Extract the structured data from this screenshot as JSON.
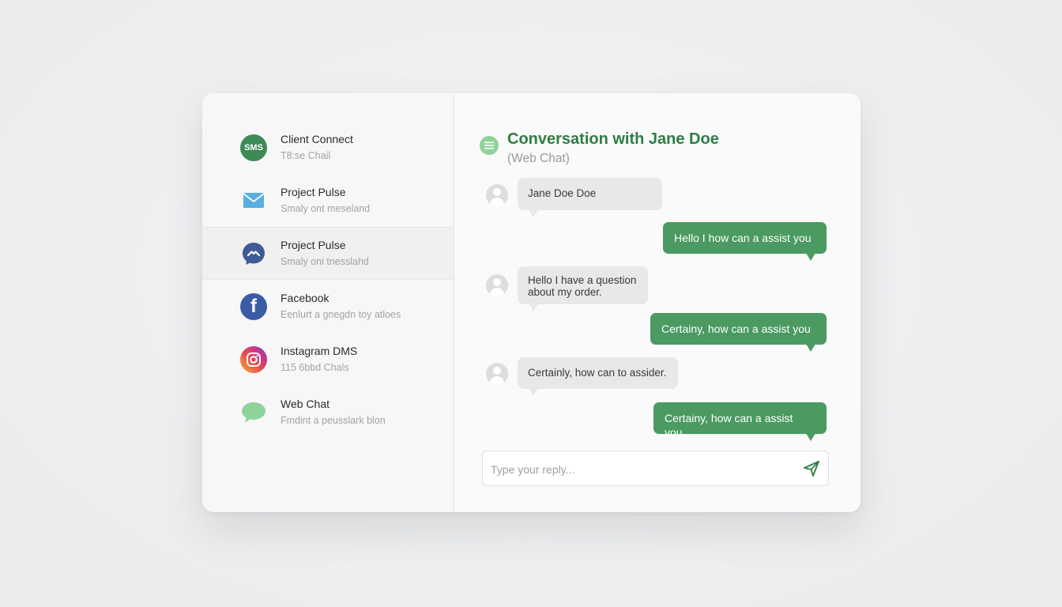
{
  "sidebar": {
    "channels": [
      {
        "name": "Client Connect",
        "subtitle": "T8:se Chail",
        "icon": "sms-badge-icon",
        "badge": "SMS"
      },
      {
        "name": "Project Pulse",
        "subtitle": "Smaly ont meseland",
        "icon": "envelope-icon"
      },
      {
        "name": "Project Pulse",
        "subtitle": "Smaly oni tnesslahd",
        "icon": "messenger-icon",
        "active": true
      },
      {
        "name": "Facebook",
        "subtitle": "Eenlurt a gnegdn toy atloes",
        "icon": "facebook-icon",
        "glyph": "f"
      },
      {
        "name": "Instagram DMS",
        "subtitle": "115 6bbd Chals",
        "icon": "instagram-icon"
      },
      {
        "name": "Web Chat",
        "subtitle": "Fmdint a peusslark blon",
        "icon": "chat-bubble-icon"
      }
    ]
  },
  "conversation": {
    "title": "Conversation with Jane Doe",
    "subtitle": "(Web Chat)",
    "header_icon": "menu-lines-icon",
    "messages": [
      {
        "direction": "in",
        "text": "Jane Doe Doe"
      },
      {
        "direction": "out",
        "text": "Hello  I how can a assist you"
      },
      {
        "direction": "in",
        "text": "Hello I have a question about my order."
      },
      {
        "direction": "out",
        "text": "Certainy, how can a assist you"
      },
      {
        "direction": "in",
        "text": "Certainly, how can to assider."
      },
      {
        "direction": "out",
        "text": "Certainy, how can a assist you."
      }
    ]
  },
  "reply": {
    "placeholder": "Type your reply...",
    "send_icon": "send-icon"
  },
  "colors": {
    "accent_green": "#4a9a62",
    "title_green": "#2e7d43",
    "incoming_bubble": "#e7e8ea"
  }
}
